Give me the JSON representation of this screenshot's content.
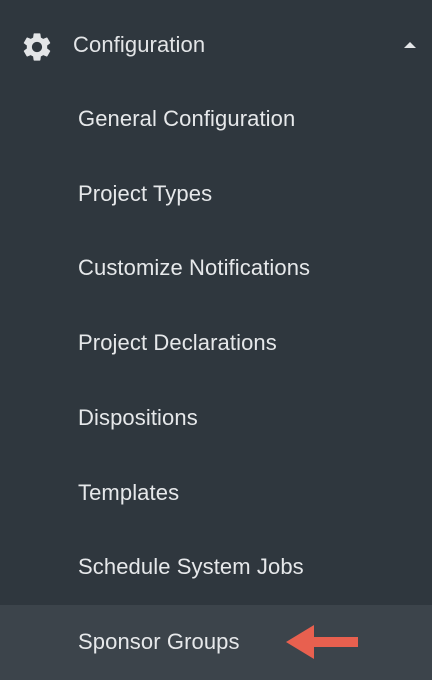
{
  "colors": {
    "background": "#2f373e",
    "active_row": "#3c444b",
    "text": "#e6e8ea",
    "arrow": "#e8604f"
  },
  "section": {
    "icon": "gear-icon",
    "label": "Configuration",
    "expanded_icon": "caret-up-icon"
  },
  "items": [
    {
      "label": "General Configuration"
    },
    {
      "label": "Project Types"
    },
    {
      "label": "Customize Notifications"
    },
    {
      "label": "Project Declarations"
    },
    {
      "label": "Dispositions"
    },
    {
      "label": "Templates"
    },
    {
      "label": "Schedule System Jobs"
    },
    {
      "label": "Sponsor Groups",
      "active": true,
      "annotation": "red-arrow-icon"
    }
  ]
}
